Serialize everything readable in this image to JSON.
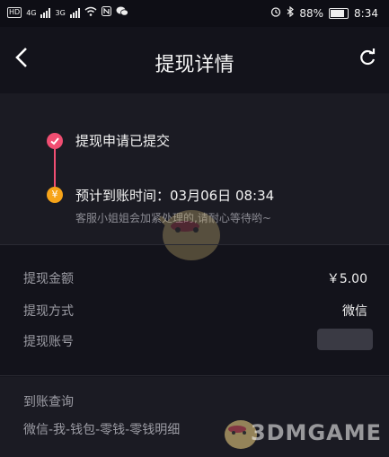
{
  "status_bar": {
    "left_badge": "HD",
    "network1": "4G",
    "network2": "3G",
    "battery": "88%",
    "time": "8:34"
  },
  "header": {
    "title": "提现详情"
  },
  "timeline": {
    "step1_label": "提现申请已提交",
    "step2_label": "预计到账时间：03月06日 08:34",
    "step2_note": "客服小姐姐会加紧处理的,请耐心等待哟~",
    "node2_symbol": "¥"
  },
  "details": {
    "amount_label": "提现金额",
    "amount_value": "￥5.00",
    "method_label": "提现方式",
    "method_value": "微信",
    "account_label": "提现账号"
  },
  "query": {
    "label": "到账查询",
    "path": "微信-我-钱包-零钱-零钱明细"
  },
  "watermark": {
    "text": "3DMGAME"
  },
  "colors": {
    "accent_red": "#f04e72",
    "accent_orange": "#f7a419"
  }
}
